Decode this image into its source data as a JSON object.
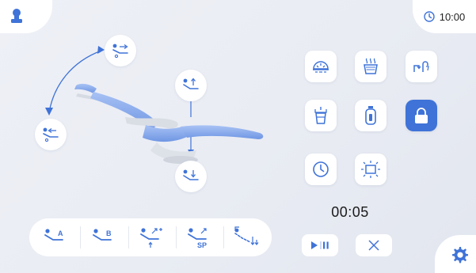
{
  "status": {
    "time": "10:00"
  },
  "timer": {
    "value": "00:05"
  },
  "chair_controls": [
    {
      "name": "backrest-up",
      "icon": "recline-arrow-right-icon"
    },
    {
      "name": "backrest-down",
      "icon": "recline-arrow-left-icon"
    },
    {
      "name": "seat-up",
      "icon": "seat-up-icon"
    },
    {
      "name": "seat-down",
      "icon": "seat-down-icon"
    }
  ],
  "function_tiles": [
    {
      "name": "operating-light",
      "icon": "dental-light-icon"
    },
    {
      "name": "cup-heater",
      "icon": "heated-water-icon"
    },
    {
      "name": "cup-filler-spittoon",
      "icon": "spittoon-rinse-icon"
    },
    {
      "name": "cup-filler",
      "icon": "cup-fill-icon"
    },
    {
      "name": "water-bottle",
      "icon": "water-bottle-icon"
    },
    {
      "name": "lock",
      "icon": "lock-icon"
    },
    {
      "name": "timer",
      "icon": "clock-icon"
    },
    {
      "name": "film-viewer",
      "icon": "viewer-light-icon"
    }
  ],
  "memory_positions": [
    {
      "label": "A"
    },
    {
      "label": "B"
    },
    {
      "label": ""
    },
    {
      "label": "SP"
    },
    {
      "label": ""
    }
  ],
  "colors": {
    "accent": "#3f73d8",
    "chair_blue": "#7ea3ea",
    "lock_tile": "#3f73d8",
    "background": "#eceef4"
  }
}
